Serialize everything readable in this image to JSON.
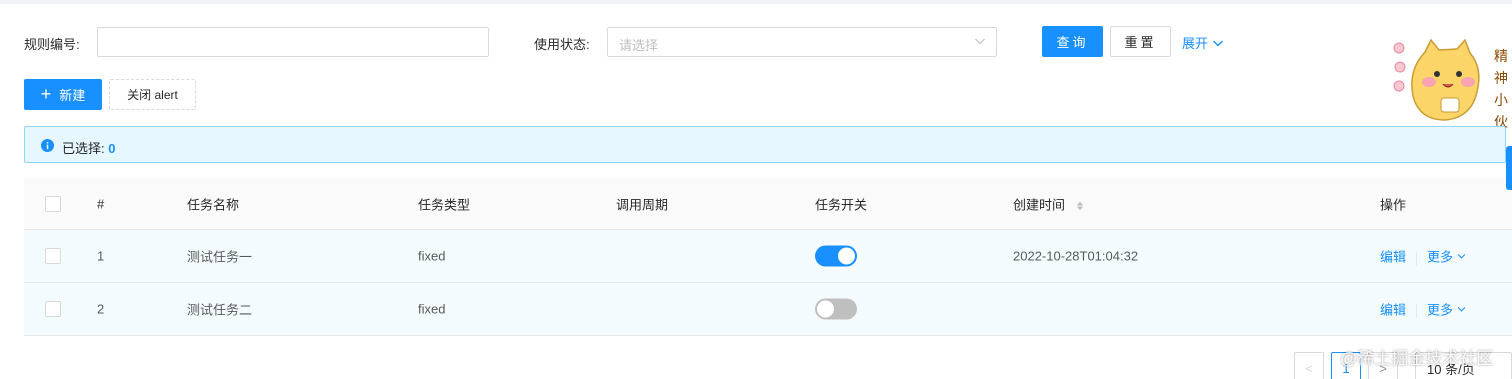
{
  "search_form": {
    "rule_no_label": "规则编号:",
    "rule_no_value": "",
    "status_label": "使用状态:",
    "status_placeholder": "请选择",
    "query_button": "查询",
    "reset_button": "重置",
    "expand_link": "展开"
  },
  "toolbar": {
    "new_button": "新建",
    "close_alert_button": "关闭 alert"
  },
  "alert": {
    "selected_label": "已选择:",
    "selected_count": "0"
  },
  "table": {
    "columns": [
      "#",
      "任务名称",
      "任务类型",
      "调用周期",
      "任务开关",
      "创建时间",
      "操作"
    ],
    "rows": [
      {
        "index": "1",
        "name": "测试任务一",
        "type": "fixed",
        "period": "",
        "enabled": true,
        "created": "2022-10-28T01:04:32",
        "edit": "编辑",
        "more": "更多"
      },
      {
        "index": "2",
        "name": "测试任务二",
        "type": "fixed",
        "period": "",
        "enabled": false,
        "created": "",
        "edit": "编辑",
        "more": "更多"
      }
    ]
  },
  "pagination": {
    "prev": "<",
    "current_page": "1",
    "next": ">",
    "page_size": "10 条/页"
  },
  "sticker": {
    "text_chars": [
      "精",
      "神",
      "小",
      "伙"
    ]
  },
  "watermark": "@稀土掘金技术社区",
  "colors": {
    "primary": "#1890ff",
    "alert_bg": "#e6f7ff",
    "alert_border": "#91d5ff",
    "row_bg": "#f4fbfe",
    "header_bg": "#fafafa"
  }
}
